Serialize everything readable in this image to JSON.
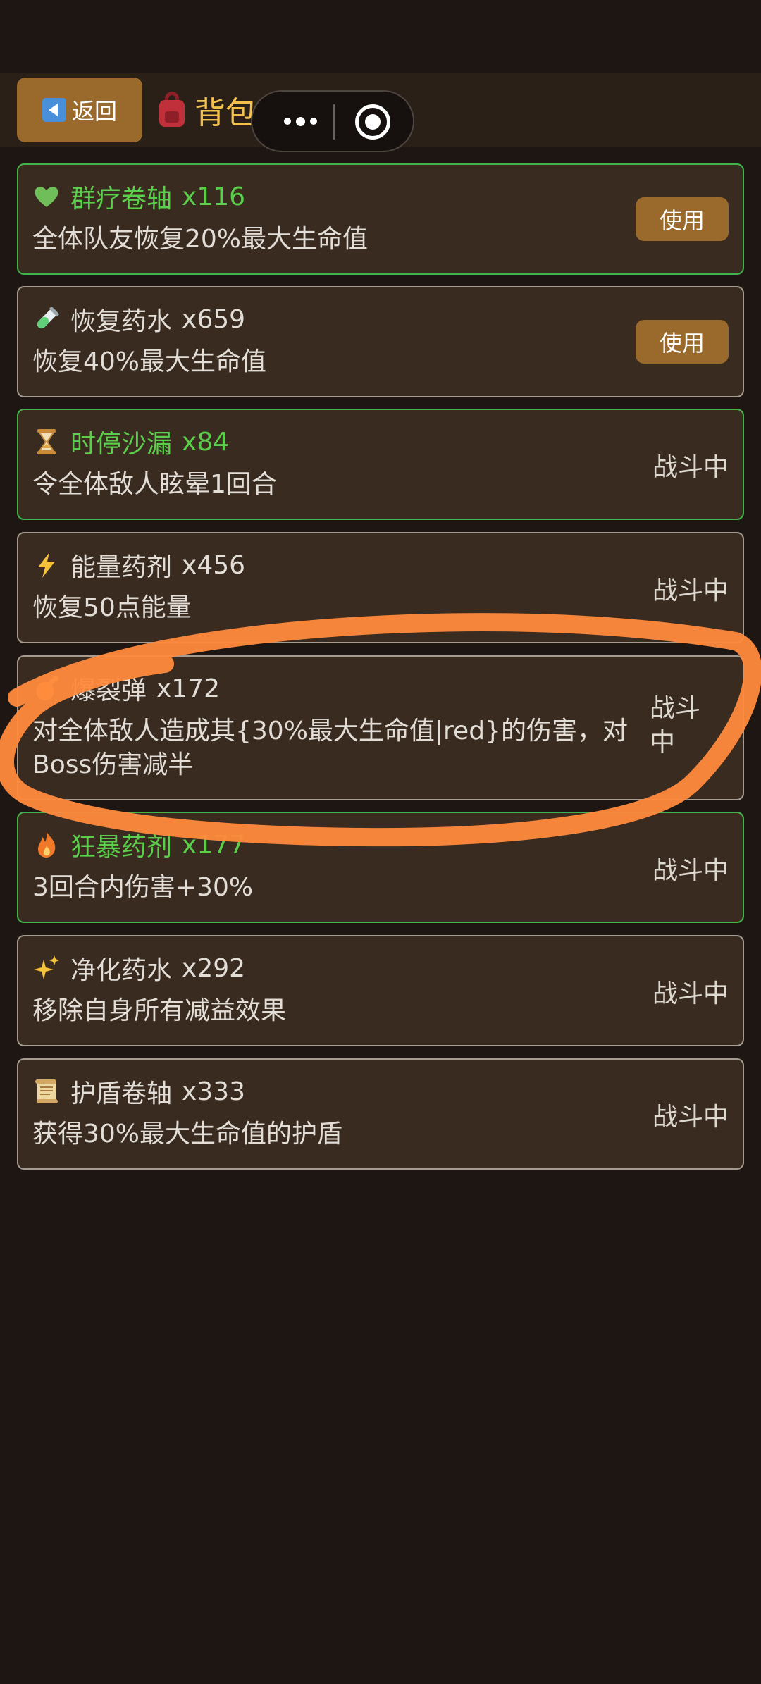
{
  "header": {
    "back_label": "返回",
    "title": "背包"
  },
  "items": [
    {
      "name": "群疗卷轴",
      "count": "x116",
      "desc": "全体队友恢复20%最大生命值",
      "action": "使用",
      "icon": "green-heart-icon"
    },
    {
      "name": "恢复药水",
      "count": "x659",
      "desc": "恢复40%最大生命值",
      "action": "使用",
      "icon": "test-tube-icon"
    },
    {
      "name": "时停沙漏",
      "count": "x84",
      "desc": "令全体敌人眩晕1回合",
      "action": "战斗中",
      "icon": "hourglass-icon"
    },
    {
      "name": "能量药剂",
      "count": "x456",
      "desc": "恢复50点能量",
      "action": "战斗中",
      "icon": "lightning-icon"
    },
    {
      "name": "爆裂弹",
      "count": "x172",
      "desc": "对全体敌人造成其{30%最大生命值|red}的伤害，对Boss伤害减半",
      "action": "战斗中",
      "icon": "bomb-icon"
    },
    {
      "name": "狂暴药剂",
      "count": "x177",
      "desc": "3回合内伤害+30%",
      "action": "战斗中",
      "icon": "fire-icon"
    },
    {
      "name": "净化药水",
      "count": "x292",
      "desc": "移除自身所有减益效果",
      "action": "战斗中",
      "icon": "sparkles-icon"
    },
    {
      "name": "护盾卷轴",
      "count": "x333",
      "desc": "获得30%最大生命值的护盾",
      "action": "战斗中",
      "icon": "scroll-icon"
    }
  ],
  "colors": {
    "background": "#1d1612",
    "card": "#392b20",
    "highlight_border": "#42b44a",
    "button": "#9a6a2c",
    "title_gold": "#f3c04a",
    "annotation_orange": "#ff8a3d"
  }
}
